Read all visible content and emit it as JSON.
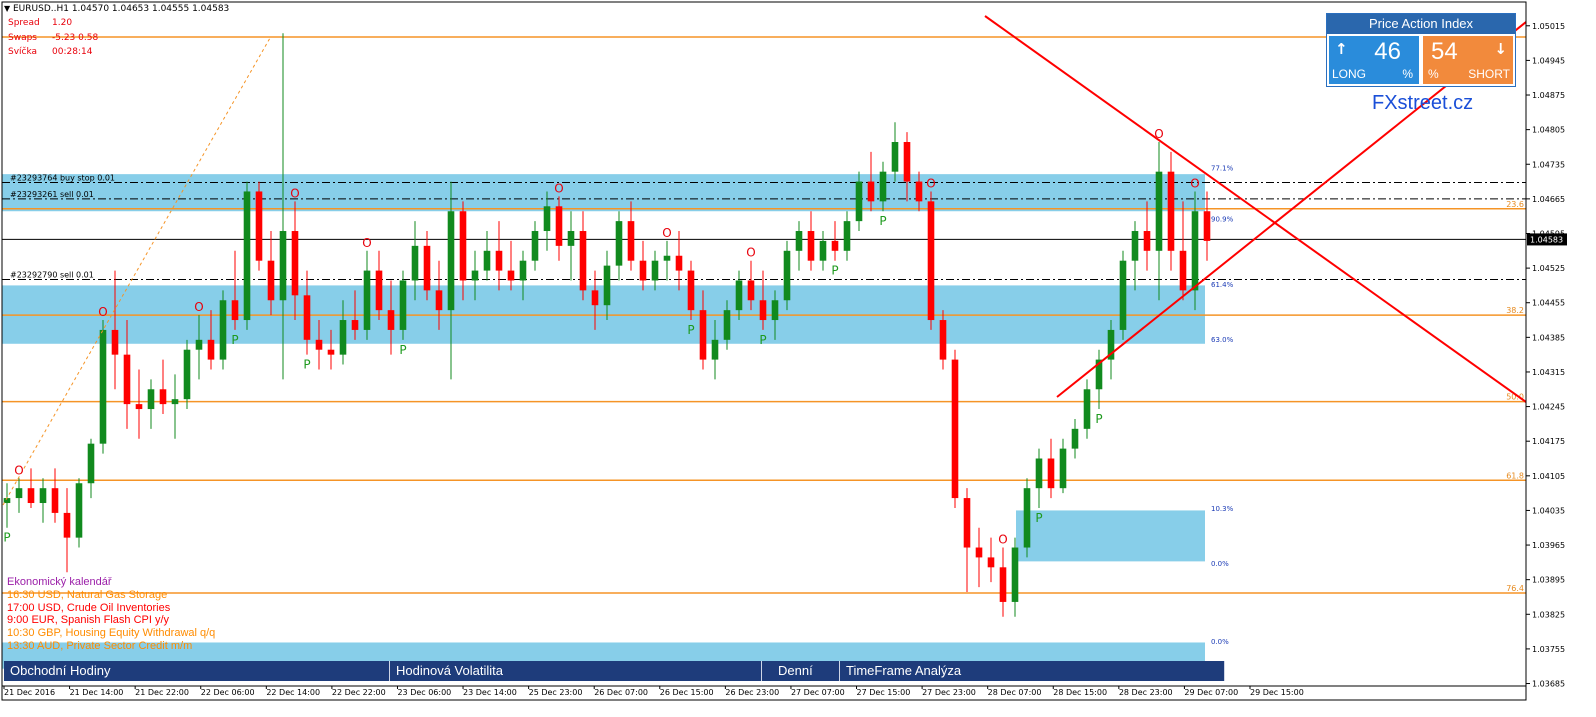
{
  "header": {
    "symbol_line": "EURUSD..H1  1.04570 1.04653 1.04555 1.04583",
    "spread_label": "Spread",
    "spread_value": "1.20",
    "swaps_label": "Swaps",
    "swaps_value": "-5.23 0.58",
    "candle_label": "Svíčka",
    "candle_value": "00:28:14"
  },
  "price_action_index": {
    "title": "Price Action Index",
    "long_value": "46",
    "long_pct": "%",
    "long_label": "LONG",
    "short_value": "54",
    "short_pct": "%",
    "short_label": "SHORT"
  },
  "brand": "FXstreet.cz",
  "calendar": {
    "title": "Ekonomický kalendář",
    "items": [
      {
        "text": "16:30 USD, Natural Gas Storage",
        "color": "#ff8c00"
      },
      {
        "text": "17:00 USD, Crude Oil Inventories",
        "color": "#ff0000"
      },
      {
        "text": "9:00 EUR, Spanish Flash CPI y/y",
        "color": "#ff0000"
      },
      {
        "text": "10:30 GBP, Housing Equity Withdrawal q/q",
        "color": "#ff8c00"
      },
      {
        "text": "13:30 AUD, Private Sector Credit m/m",
        "color": "#ff8c00"
      }
    ]
  },
  "bottom_tabs": [
    "Obchodní Hodiny",
    "Hodinová Volatilita",
    "Denní",
    "TimeFrame Analýza"
  ],
  "chart_data": {
    "type": "candlestick",
    "symbol": "EURUSD..H1",
    "ylim": [
      1.0368,
      1.05055
    ],
    "y_ticks": [
      "1.05015",
      "1.04945",
      "1.04875",
      "1.04805",
      "1.04735",
      "1.04665",
      "1.04595",
      "1.04525",
      "1.04455",
      "1.04385",
      "1.04315",
      "1.04245",
      "1.04175",
      "1.04105",
      "1.04035",
      "1.03965",
      "1.03895",
      "1.03825",
      "1.03755",
      "1.03685"
    ],
    "current_price": "1.04583",
    "x_labels": [
      "21 Dec 2016",
      "21 Dec 14:00",
      "21 Dec 22:00",
      "22 Dec 06:00",
      "22 Dec 14:00",
      "22 Dec 22:00",
      "23 Dec 06:00",
      "23 Dec 14:00",
      "25 Dec 23:00",
      "26 Dec 07:00",
      "26 Dec 15:00",
      "26 Dec 23:00",
      "27 Dec 07:00",
      "27 Dec 15:00",
      "27 Dec 23:00",
      "28 Dec 07:00",
      "28 Dec 15:00",
      "28 Dec 23:00",
      "29 Dec 07:00",
      "29 Dec 15:00"
    ],
    "fib_levels": [
      {
        "label": "76.4",
        "price": 1.03868
      },
      {
        "label": "61.8",
        "price": 1.04096
      },
      {
        "label": "50.0",
        "price": 1.04255
      },
      {
        "label": "38.2",
        "price": 1.0443
      },
      {
        "label": "23.6",
        "price": 1.04645
      }
    ],
    "pattern_levels": [
      {
        "label": "77.1%",
        "price": 1.04728
      },
      {
        "label": "90.9%",
        "price": 1.04625
      },
      {
        "label": "61.4%",
        "price": 1.04493
      },
      {
        "label": "63.0%",
        "price": 1.04382
      },
      {
        "label": "10.3%",
        "price": 1.0404
      },
      {
        "label": "0.0%",
        "price": 1.03929
      },
      {
        "label": "0.0%",
        "price": 1.03771
      }
    ],
    "orders": [
      {
        "label": "#23293764 buy stop 0.01",
        "price": 1.04698
      },
      {
        "label": "#23293261 sell 0.01",
        "price": 1.04665
      },
      {
        "label": "#23292790 sell 0.01",
        "price": 1.04502
      }
    ],
    "zones": [
      {
        "from": 1.0464,
        "to": 1.04715
      },
      {
        "from": 1.04372,
        "to": 1.0449
      },
      {
        "from": 1.03932,
        "to": 1.04035
      },
      {
        "from": 1.03715,
        "to": 1.03768
      }
    ],
    "markers": [
      "P",
      "O"
    ],
    "ohlc": [
      [
        1.0405,
        1.0409,
        1.04,
        1.0406
      ],
      [
        1.0406,
        1.041,
        1.0403,
        1.0408
      ],
      [
        1.0408,
        1.0412,
        1.0404,
        1.0405
      ],
      [
        1.0405,
        1.041,
        1.0401,
        1.0408
      ],
      [
        1.0408,
        1.0412,
        1.0401,
        1.0403
      ],
      [
        1.0403,
        1.0408,
        1.0391,
        1.0398
      ],
      [
        1.0398,
        1.041,
        1.0396,
        1.0409
      ],
      [
        1.0409,
        1.0418,
        1.0406,
        1.0417
      ],
      [
        1.0417,
        1.0442,
        1.0415,
        1.044
      ],
      [
        1.044,
        1.0452,
        1.0428,
        1.0435
      ],
      [
        1.0435,
        1.0442,
        1.042,
        1.0425
      ],
      [
        1.0425,
        1.0432,
        1.0418,
        1.0424
      ],
      [
        1.0424,
        1.043,
        1.042,
        1.0428
      ],
      [
        1.0428,
        1.0434,
        1.0423,
        1.0425
      ],
      [
        1.0425,
        1.0431,
        1.0418,
        1.0426
      ],
      [
        1.0426,
        1.0438,
        1.0424,
        1.0436
      ],
      [
        1.0436,
        1.0443,
        1.043,
        1.0438
      ],
      [
        1.0438,
        1.0444,
        1.0432,
        1.0434
      ],
      [
        1.0434,
        1.0448,
        1.0432,
        1.0446
      ],
      [
        1.0446,
        1.0456,
        1.044,
        1.0442
      ],
      [
        1.0442,
        1.047,
        1.044,
        1.0468
      ],
      [
        1.0468,
        1.047,
        1.0452,
        1.0454
      ],
      [
        1.0454,
        1.046,
        1.0443,
        1.0446
      ],
      [
        1.0446,
        1.05,
        1.043,
        1.046
      ],
      [
        1.046,
        1.0466,
        1.0442,
        1.0447
      ],
      [
        1.0447,
        1.0452,
        1.0435,
        1.0438
      ],
      [
        1.0438,
        1.0442,
        1.0432,
        1.0436
      ],
      [
        1.0436,
        1.044,
        1.0432,
        1.0435
      ],
      [
        1.0435,
        1.0446,
        1.0433,
        1.0442
      ],
      [
        1.0442,
        1.0448,
        1.0438,
        1.044
      ],
      [
        1.044,
        1.0456,
        1.0438,
        1.0452
      ],
      [
        1.0452,
        1.0456,
        1.0442,
        1.0444
      ],
      [
        1.0444,
        1.045,
        1.0435,
        1.044
      ],
      [
        1.044,
        1.0452,
        1.0438,
        1.045
      ],
      [
        1.045,
        1.0462,
        1.0446,
        1.0457
      ],
      [
        1.0457,
        1.046,
        1.0446,
        1.0448
      ],
      [
        1.0448,
        1.0454,
        1.044,
        1.0444
      ],
      [
        1.0444,
        1.047,
        1.043,
        1.0464
      ],
      [
        1.0464,
        1.0466,
        1.0446,
        1.045
      ],
      [
        1.045,
        1.0456,
        1.0446,
        1.0452
      ],
      [
        1.0452,
        1.046,
        1.045,
        1.0456
      ],
      [
        1.0456,
        1.0462,
        1.0448,
        1.0452
      ],
      [
        1.0452,
        1.0458,
        1.0448,
        1.045
      ],
      [
        1.045,
        1.0456,
        1.0446,
        1.0454
      ],
      [
        1.0454,
        1.0462,
        1.0452,
        1.046
      ],
      [
        1.046,
        1.0468,
        1.0456,
        1.0465
      ],
      [
        1.0465,
        1.0467,
        1.0454,
        1.0457
      ],
      [
        1.0457,
        1.0464,
        1.045,
        1.046
      ],
      [
        1.046,
        1.0464,
        1.0446,
        1.0448
      ],
      [
        1.0448,
        1.0452,
        1.044,
        1.0445
      ],
      [
        1.0445,
        1.0456,
        1.0442,
        1.0453
      ],
      [
        1.0453,
        1.0464,
        1.045,
        1.0462
      ],
      [
        1.0462,
        1.0466,
        1.0452,
        1.0454
      ],
      [
        1.0454,
        1.0458,
        1.0448,
        1.045
      ],
      [
        1.045,
        1.0456,
        1.0448,
        1.0454
      ],
      [
        1.0454,
        1.0458,
        1.045,
        1.0455
      ],
      [
        1.0455,
        1.046,
        1.0448,
        1.0452
      ],
      [
        1.0452,
        1.0454,
        1.0442,
        1.0444
      ],
      [
        1.0444,
        1.0448,
        1.0432,
        1.0434
      ],
      [
        1.0434,
        1.0442,
        1.043,
        1.0438
      ],
      [
        1.0438,
        1.0446,
        1.0436,
        1.0444
      ],
      [
        1.0444,
        1.0452,
        1.0442,
        1.045
      ],
      [
        1.045,
        1.0454,
        1.0444,
        1.0446
      ],
      [
        1.0446,
        1.0452,
        1.044,
        1.0442
      ],
      [
        1.0442,
        1.0448,
        1.0438,
        1.0446
      ],
      [
        1.0446,
        1.0458,
        1.0444,
        1.0456
      ],
      [
        1.0456,
        1.0462,
        1.0452,
        1.046
      ],
      [
        1.046,
        1.0464,
        1.0452,
        1.0454
      ],
      [
        1.0454,
        1.046,
        1.0452,
        1.0458
      ],
      [
        1.0458,
        1.0462,
        1.0454,
        1.0456
      ],
      [
        1.0456,
        1.0464,
        1.0454,
        1.0462
      ],
      [
        1.0462,
        1.0472,
        1.046,
        1.047
      ],
      [
        1.047,
        1.0476,
        1.0464,
        1.0466
      ],
      [
        1.0466,
        1.0474,
        1.0464,
        1.0472
      ],
      [
        1.0472,
        1.0482,
        1.047,
        1.0478
      ],
      [
        1.0478,
        1.048,
        1.0466,
        1.047
      ],
      [
        1.047,
        1.0472,
        1.0464,
        1.0466
      ],
      [
        1.0466,
        1.0468,
        1.044,
        1.0442
      ],
      [
        1.0442,
        1.0444,
        1.0432,
        1.0434
      ],
      [
        1.0434,
        1.0436,
        1.0404,
        1.0406
      ],
      [
        1.0406,
        1.0408,
        1.0387,
        1.0396
      ],
      [
        1.0396,
        1.04,
        1.0388,
        1.0394
      ],
      [
        1.0394,
        1.0398,
        1.0389,
        1.0392
      ],
      [
        1.0392,
        1.0396,
        1.0382,
        1.0385
      ],
      [
        1.0385,
        1.0398,
        1.0382,
        1.0396
      ],
      [
        1.0396,
        1.041,
        1.0394,
        1.0408
      ],
      [
        1.0408,
        1.0416,
        1.0404,
        1.0414
      ],
      [
        1.0414,
        1.0418,
        1.0406,
        1.0408
      ],
      [
        1.0408,
        1.0418,
        1.0407,
        1.0416
      ],
      [
        1.0416,
        1.0422,
        1.0414,
        1.042
      ],
      [
        1.042,
        1.043,
        1.0418,
        1.0428
      ],
      [
        1.0428,
        1.0436,
        1.0424,
        1.0434
      ],
      [
        1.0434,
        1.0442,
        1.043,
        1.044
      ],
      [
        1.044,
        1.0456,
        1.0438,
        1.0454
      ],
      [
        1.0454,
        1.0462,
        1.0448,
        1.046
      ],
      [
        1.046,
        1.0466,
        1.0452,
        1.0456
      ],
      [
        1.0456,
        1.0478,
        1.0446,
        1.0472
      ],
      [
        1.0472,
        1.0476,
        1.0452,
        1.0456
      ],
      [
        1.0456,
        1.0466,
        1.0446,
        1.0448
      ],
      [
        1.0448,
        1.0468,
        1.0444,
        1.0464
      ],
      [
        1.0464,
        1.0468,
        1.0454,
        1.0458
      ]
    ]
  }
}
